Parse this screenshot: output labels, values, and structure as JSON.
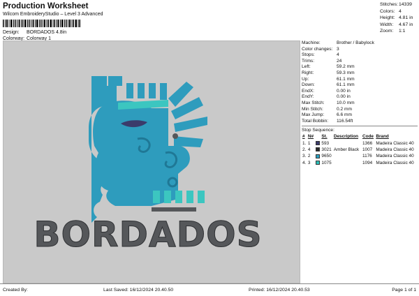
{
  "header": {
    "title": "Production Worksheet",
    "subtitle": "Wilcom EmbroideryStudio – Level 3 Advanced",
    "design_label": "Design:",
    "design_value": "BORDADOS 4.8in",
    "colorway_label": "Colorway:",
    "colorway_value": "Colorway 1"
  },
  "stats": [
    {
      "label": "Stitches:",
      "value": "14339"
    },
    {
      "label": "Colors:",
      "value": "4"
    },
    {
      "label": "Height:",
      "value": "4.81 in"
    },
    {
      "label": "Width:",
      "value": "4.67 in"
    },
    {
      "label": "Zoom:",
      "value": "1:1"
    }
  ],
  "info": [
    {
      "label": "Machine:",
      "value": "Brother / Babylock"
    },
    {
      "label": "Color changes:",
      "value": "3"
    },
    {
      "label": "Stops:",
      "value": "4"
    },
    {
      "label": "Trims:",
      "value": "24"
    },
    {
      "label": "Left:",
      "value": "59.2 mm"
    },
    {
      "label": "Right:",
      "value": "59.3 mm"
    },
    {
      "label": "Up:",
      "value": "61.1 mm"
    },
    {
      "label": "Down:",
      "value": "61.1 mm"
    },
    {
      "label": "EndX:",
      "value": "0.00 in"
    },
    {
      "label": "EndY:",
      "value": "0.00 in"
    },
    {
      "label": "Max Stitch:",
      "value": "10.0 mm"
    },
    {
      "label": "Min Stitch:",
      "value": "0.2 mm"
    },
    {
      "label": "Max Jump:",
      "value": "6.6 mm"
    },
    {
      "label": "Total Bobbin:",
      "value": "116.54ft"
    }
  ],
  "stop_sequence": {
    "title": "Stop Sequence:",
    "columns": [
      "#",
      "N#",
      "",
      "St.",
      "Description",
      "Code",
      "Brand"
    ],
    "rows": [
      {
        "num": "1.",
        "n": "1",
        "color": "#3b3b6b",
        "st": "593",
        "desc": "",
        "code": "1366",
        "brand": "Madeira Classic 40"
      },
      {
        "num": "2.",
        "n": "4",
        "color": "#2a2a2a",
        "st": "3021",
        "desc": "Amber Black",
        "code": "1007",
        "brand": "Madeira Classic 40"
      },
      {
        "num": "3.",
        "n": "2",
        "color": "#2a9fbf",
        "st": "9650",
        "desc": "",
        "code": "1176",
        "brand": "Madeira Classic 40"
      },
      {
        "num": "4.",
        "n": "3",
        "color": "#2bbfb8",
        "st": "1075",
        "desc": "",
        "code": "1094",
        "brand": "Madeira Classic 40"
      }
    ]
  },
  "design": {
    "text": "BORDADOS",
    "colors": {
      "blue": "#2e9cbd",
      "teal": "#3cc6c0",
      "navy": "#3b3b6b",
      "dark": "#55575a"
    }
  },
  "footer": {
    "created_by": "Created By:",
    "last_saved": "Last Saved: 16/12/2024 20.40.50",
    "printed": "Printed: 16/12/2024 20.40.53",
    "page": "Page 1 of 1"
  }
}
